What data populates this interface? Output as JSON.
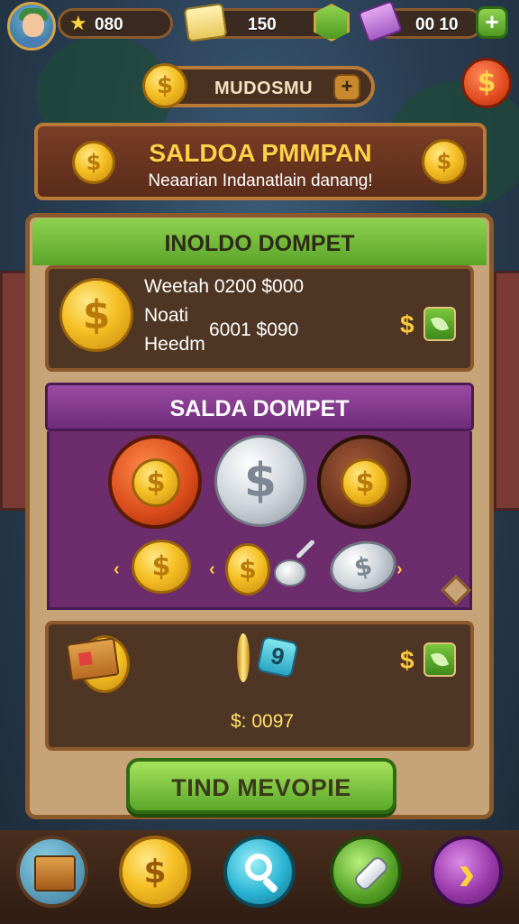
{
  "top_bar": {
    "stars_value": "080",
    "cash_value": "150",
    "gems_value": "00 10"
  },
  "title_pill": {
    "label": "MUDOSMU"
  },
  "banner": {
    "title": "SALDOA PMMPAN",
    "subtitle": "Neaarian Indanatlain danang!"
  },
  "wallet_info": {
    "header": "INOLDO DOMPET",
    "line1": "Weetah 0200 $000",
    "line2": "Noati",
    "line3": "Heedm",
    "amount": "6001 $090",
    "dollar": "$"
  },
  "saldo": {
    "header": "SALDA DOMPET"
  },
  "reward": {
    "value": "9",
    "balance": "$: 0097",
    "dollar": "$"
  },
  "cta": {
    "label": "TIND MEVOPIE"
  },
  "symbols": {
    "dollar": "$",
    "star": "★",
    "plus": "+",
    "arrow_left": "‹",
    "arrow_right": "›",
    "chevron": "›"
  },
  "colors": {
    "gold": "#f5c024",
    "green": "#5aa52a",
    "purple": "#6d2c6b",
    "wood": "#8a5a2c"
  }
}
